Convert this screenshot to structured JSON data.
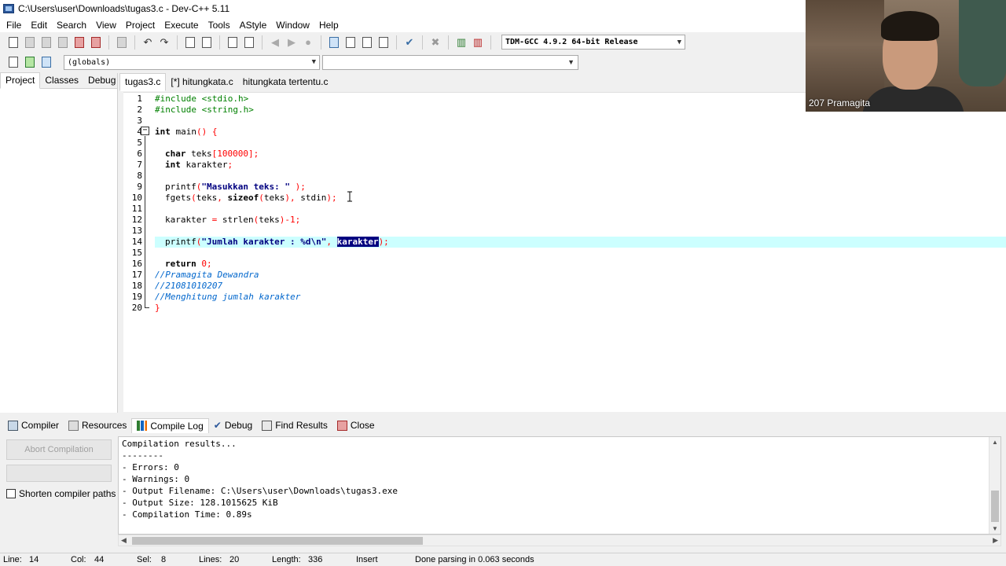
{
  "window": {
    "title": "C:\\Users\\user\\Downloads\\tugas3.c - Dev-C++ 5.11"
  },
  "menu": [
    "File",
    "Edit",
    "Search",
    "View",
    "Project",
    "Execute",
    "Tools",
    "AStyle",
    "Window",
    "Help"
  ],
  "toolbar": {
    "compiler": "TDM-GCC 4.9.2 64-bit Release",
    "globals": "(globals)",
    "member": ""
  },
  "left_panel": {
    "tabs": [
      "Project",
      "Classes",
      "Debug"
    ],
    "active": "Project"
  },
  "editor_tabs": [
    "tugas3.c",
    "[*] hitungkata.c",
    "hitungkata tertentu.c"
  ],
  "code": {
    "line_numbers": [
      "1",
      "2",
      "3",
      "4",
      "5",
      "6",
      "7",
      "8",
      "9",
      "10",
      "11",
      "12",
      "13",
      "14",
      "15",
      "16",
      "17",
      "18",
      "19",
      "20"
    ],
    "l1": "#include <stdio.h>",
    "l2": "#include <string.h>",
    "l4_kw": "int",
    "l4_rest": " main",
    "l4_paren": "()",
    "l4_brace": " {",
    "l6_kw": "char",
    "l6_rest": " teks",
    "l6_num": "[100000]",
    "l6_end": ";",
    "l7_kw": "int",
    "l7_rest": " karakter",
    "l7_end": ";",
    "l9_fn": "printf",
    "l9_p1": "(",
    "l9_str": "\"Masukkan teks: \"",
    "l9_p2": " );",
    "l10_fn": "fgets",
    "l10_p1": "(",
    "l10_a": "teks",
    "l10_c1": ", ",
    "l10_kw": "sizeof",
    "l10_p2": "(",
    "l10_b": "teks",
    "l10_p3": "), ",
    "l10_c": "stdin",
    "l10_p4": ");",
    "l12_a": "karakter",
    "l12_eq": " = ",
    "l12_fn": "strlen",
    "l12_p1": "(",
    "l12_b": "teks",
    "l12_p2": ")-",
    "l12_num": "1",
    "l12_end": ";",
    "l14_fn": "printf",
    "l14_p1": "(",
    "l14_str": "\"Jumlah karakter : %d\\n\"",
    "l14_c": ", ",
    "l14_sel": "karakter",
    "l14_end": ");",
    "l16_kw": "return",
    "l16_num": " 0",
    "l16_end": ";",
    "l17": "//Pramagita Dewandra",
    "l18": "//21081010207",
    "l19": "//Menghitung jumlah karakter",
    "l20": "}"
  },
  "bottom_tabs": [
    "Compiler",
    "Resources",
    "Compile Log",
    "Debug",
    "Find Results",
    "Close"
  ],
  "bottom_active": "Compile Log",
  "bottom_left": {
    "abort_label": "Abort Compilation",
    "shorten_label": "Shorten compiler paths"
  },
  "log_lines": [
    "Compilation results...",
    "--------",
    "- Errors: 0",
    "- Warnings: 0",
    "- Output Filename: C:\\Users\\user\\Downloads\\tugas3.exe",
    "- Output Size: 128.1015625 KiB",
    "- Compilation Time: 0.89s"
  ],
  "status": {
    "line_label": "Line:",
    "line": "14",
    "col_label": "Col:",
    "col": "44",
    "sel_label": "Sel:",
    "sel": "8",
    "lines_label": "Lines:",
    "lines": "20",
    "length_label": "Length:",
    "length": "336",
    "mode": "Insert",
    "message": "Done parsing in 0.063 seconds"
  },
  "webcam": {
    "name": "207 Pramagita"
  }
}
